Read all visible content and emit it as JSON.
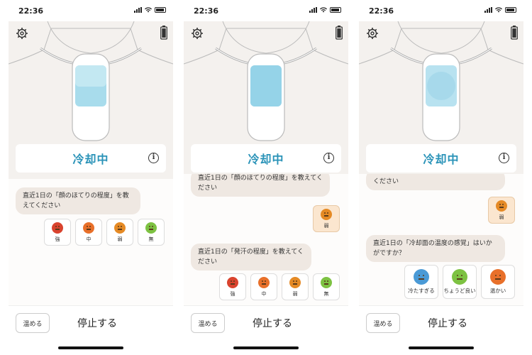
{
  "status_bar": {
    "time": "22:36"
  },
  "colors": {
    "accent": "#2a93b8",
    "face_strong": "#d9432e",
    "face_medium": "#e8702a",
    "face_weak": "#e58a25",
    "face_none": "#7dc242",
    "face_cool": "#4a9ad6",
    "face_good": "#7dc242",
    "face_warm": "#e8702a"
  },
  "screens": [
    {
      "status_title": "冷却中",
      "bubbles": [
        "直近1日の「顔のほてりの程度」を教えてください"
      ],
      "options": [
        {
          "label": "強",
          "icon": "face-strong-icon"
        },
        {
          "label": "中",
          "icon": "face-medium-icon"
        },
        {
          "label": "弱",
          "icon": "face-weak-icon"
        },
        {
          "label": "無",
          "icon": "face-none-icon"
        }
      ],
      "warm_label": "温める",
      "stop_label": "停止する"
    },
    {
      "status_title": "冷却中",
      "bubbles": [
        "直近1日の「顔のほてりの程度」を教えてください",
        "直近1日の「発汗の程度」を教えてください"
      ],
      "answer": {
        "label": "弱",
        "icon": "face-weak-icon"
      },
      "options": [
        {
          "label": "強",
          "icon": "face-strong-icon"
        },
        {
          "label": "中",
          "icon": "face-medium-icon"
        },
        {
          "label": "弱",
          "icon": "face-weak-icon"
        },
        {
          "label": "無",
          "icon": "face-none-icon"
        }
      ],
      "warm_label": "温める",
      "stop_label": "停止する"
    },
    {
      "status_title": "冷却中",
      "bubbles": [
        "ください",
        "直近1日の「冷却面の温度の感覚」はいかがですか？"
      ],
      "answer": {
        "label": "弱",
        "icon": "face-weak-icon"
      },
      "options": [
        {
          "label": "冷たすぎる",
          "icon": "face-too-cold-icon"
        },
        {
          "label": "ちょうど良い",
          "icon": "face-just-right-icon"
        },
        {
          "label": "温かい",
          "icon": "face-warm-icon"
        }
      ],
      "warm_label": "温める",
      "stop_label": "停止する"
    }
  ]
}
